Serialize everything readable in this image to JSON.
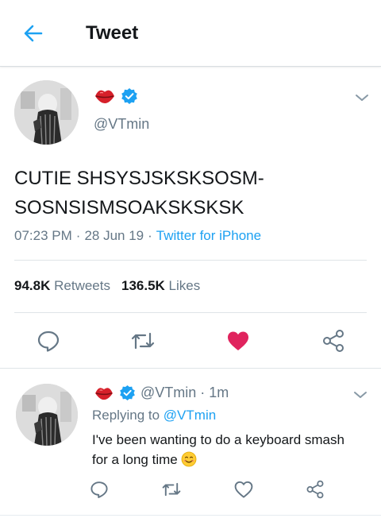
{
  "header": {
    "title": "Tweet"
  },
  "tweet": {
    "handle": "@VTmin",
    "text": "CUTIE SHSYSJSKSKSOSM-\nSOSNSISMSOAKSKSKSK",
    "time": "07:23 PM",
    "date": "28 Jun 19",
    "source": "Twitter for iPhone",
    "retweets_count": "94.8K",
    "retweets_label": "Retweets",
    "likes_count": "136.5K",
    "likes_label": "Likes",
    "liked": true
  },
  "reply": {
    "handle": "@VTmin",
    "time": "1m",
    "replying_prefix": "Replying to",
    "replying_to": "@VTmin",
    "text": "I've been wanting to do a keyboard smash for a long time"
  },
  "colors": {
    "accent": "#1da1f2",
    "like": "#e0245e",
    "muted": "#657786",
    "verified": "#1da1f2"
  },
  "icons": {
    "back": "arrow-left-icon",
    "lips": "lips-emoji-icon",
    "verified": "verified-badge-icon",
    "chevron": "chevron-down-icon",
    "reply": "reply-icon",
    "retweet": "retweet-icon",
    "like": "heart-icon",
    "share": "share-icon",
    "smile": "smiling-face-emoji-icon"
  }
}
